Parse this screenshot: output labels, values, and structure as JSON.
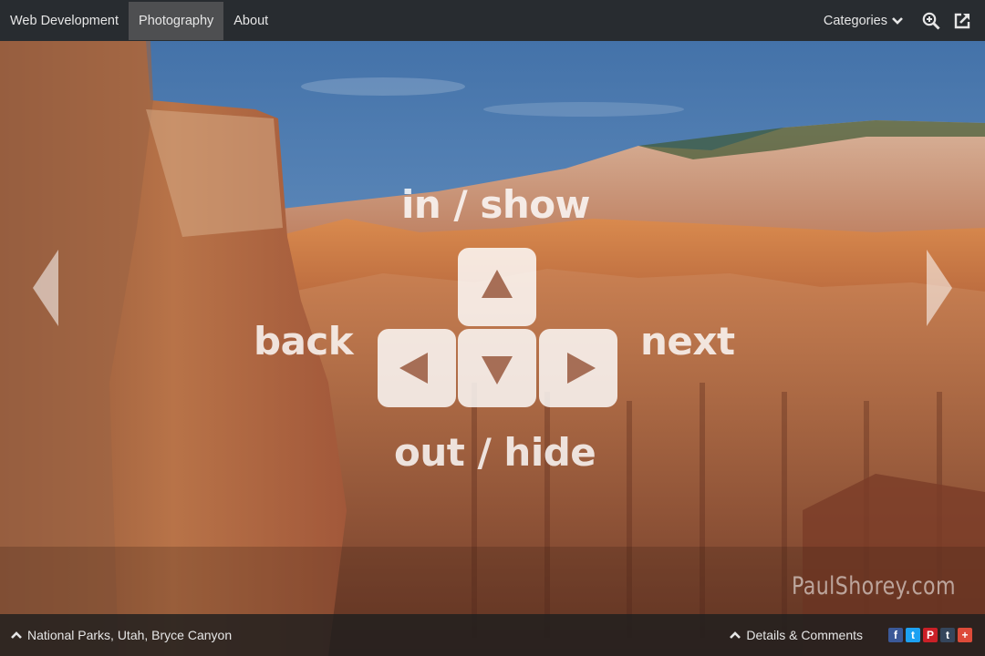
{
  "nav": {
    "items": [
      {
        "label": "Web Development"
      },
      {
        "label": "Photography"
      },
      {
        "label": "About"
      }
    ],
    "categories_label": "Categories"
  },
  "overlay": {
    "in_show": "in / show",
    "back": "back",
    "next": "next",
    "out_hide": "out / hide"
  },
  "watermark": "PaulShorey.com",
  "footer": {
    "breadcrumb": "National Parks, Utah, Bryce Canyon",
    "details_label": "Details & Comments",
    "share": [
      {
        "glyph": "f",
        "color": "#3b5998"
      },
      {
        "glyph": "t",
        "color": "#1da1f2"
      },
      {
        "glyph": "P",
        "color": "#cb2027"
      },
      {
        "glyph": "t",
        "color": "#35465c"
      },
      {
        "glyph": "+",
        "color": "#dd4b39"
      }
    ]
  },
  "colors": {
    "bar": "#262626",
    "active_tab": "#5e5e5e"
  }
}
